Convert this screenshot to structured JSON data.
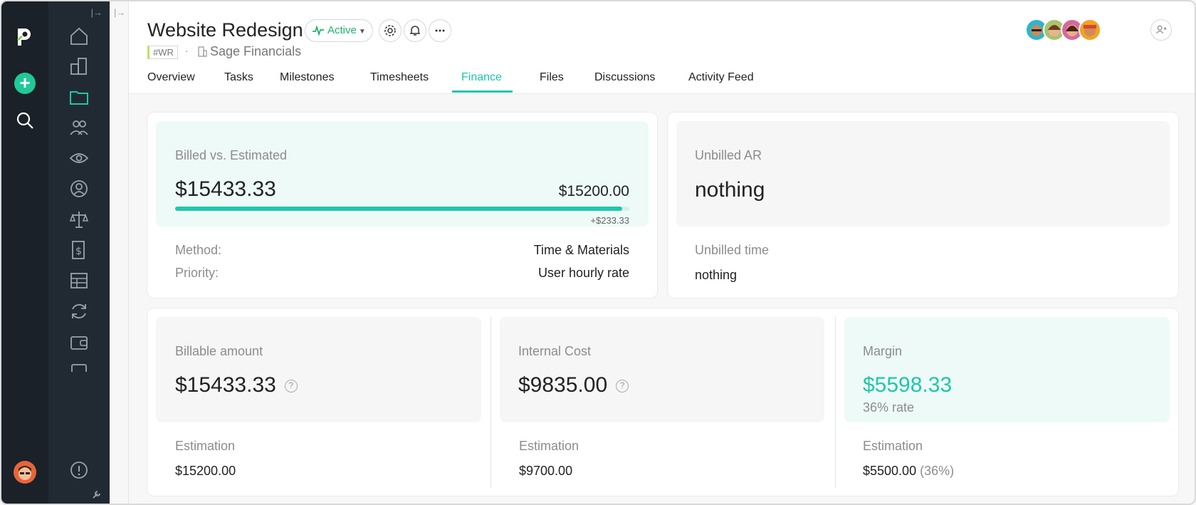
{
  "project": {
    "title": "Website Redesign",
    "status": "Active",
    "tag": "#WR",
    "client": "Sage Financials"
  },
  "tabs": [
    "Overview",
    "Tasks",
    "Milestones",
    "Timesheets",
    "Finance",
    "Files",
    "Discussions",
    "Activity Feed"
  ],
  "active_tab": "Finance",
  "billed": {
    "label": "Billed vs. Estimated",
    "billed_value": "$15433.33",
    "estimated_value": "$15200.00",
    "over": "+$233.33",
    "progress_fraction": 0.985,
    "method_label": "Method:",
    "method_value": "Time & Materials",
    "priority_label": "Priority:",
    "priority_value": "User hourly rate"
  },
  "unbilled": {
    "ar_label": "Unbilled AR",
    "ar_value": "nothing",
    "time_label": "Unbilled time",
    "time_value": "nothing"
  },
  "billable": {
    "label": "Billable amount",
    "value": "$15433.33",
    "help": "?",
    "est_label": "Estimation",
    "est_value": "$15200.00"
  },
  "internal": {
    "label": "Internal Cost",
    "value": "$9835.00",
    "help": "?",
    "est_label": "Estimation",
    "est_value": "$9700.00"
  },
  "margin": {
    "label": "Margin",
    "value": "$5598.33",
    "rate": "36% rate",
    "est_label": "Estimation",
    "est_value": "$5500.00",
    "est_pct": "(36%)"
  },
  "colors": {
    "accent": "#1ec7a9",
    "active_green": "#1fb36b",
    "rail": "#1a2129",
    "sidebar": "#212a33"
  }
}
